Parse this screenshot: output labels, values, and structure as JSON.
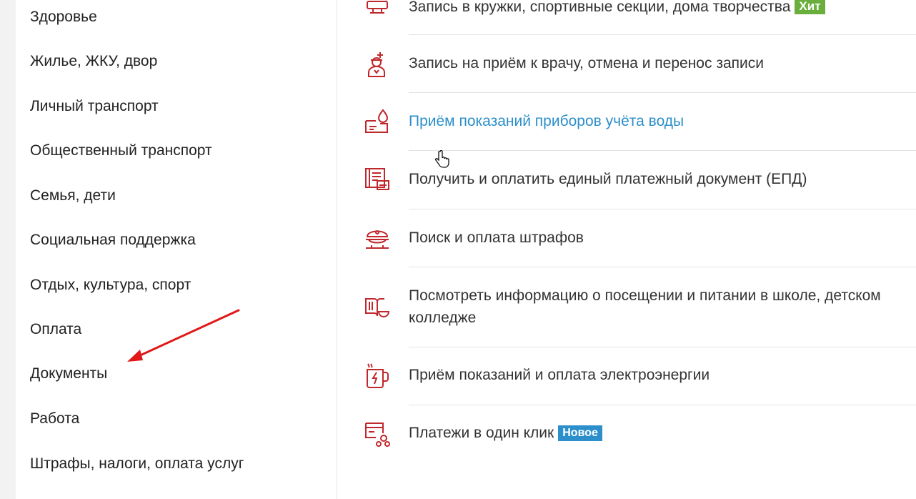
{
  "sidebar": {
    "items": [
      {
        "label": "Здоровье"
      },
      {
        "label": "Жилье, ЖКУ, двор"
      },
      {
        "label": "Личный транспорт"
      },
      {
        "label": "Общественный транспорт"
      },
      {
        "label": "Семья, дети"
      },
      {
        "label": "Социальная поддержка"
      },
      {
        "label": "Отдых, культура, спорт"
      },
      {
        "label": "Оплата"
      },
      {
        "label": "Документы"
      },
      {
        "label": "Работа"
      },
      {
        "label": "Штрафы, налоги, оплата услуг"
      }
    ]
  },
  "services": [
    {
      "label": "Запись в кружки, спортивные секции, дома творчества",
      "badge": "Хит",
      "icon": "clubs-icon"
    },
    {
      "label": "Запись на приём к врачу, отмена и перенос записи",
      "icon": "doctor-icon"
    },
    {
      "label": "Приём показаний приборов учёта воды",
      "icon": "water-meter-icon"
    },
    {
      "label": "Получить и оплатить единый платежный документ (ЕПД)",
      "icon": "payment-document-icon"
    },
    {
      "label": "Поиск и оплата штрафов",
      "icon": "police-cap-icon"
    },
    {
      "label": "Посмотреть информацию о посещении и питании в школе, детском колледже",
      "icon": "school-meals-icon"
    },
    {
      "label": "Приём показаний и оплата электроэнергии",
      "icon": "electricity-icon"
    },
    {
      "label": "Платежи в один клик",
      "badge": "Новое",
      "icon": "one-click-payment-icon"
    }
  ],
  "colors": {
    "icon": "#c0282d",
    "link": "#2c8fcb",
    "badge_hit": "#6aaf3d",
    "badge_new": "#2c8fcb",
    "annotation_arrow": "#e01818"
  }
}
